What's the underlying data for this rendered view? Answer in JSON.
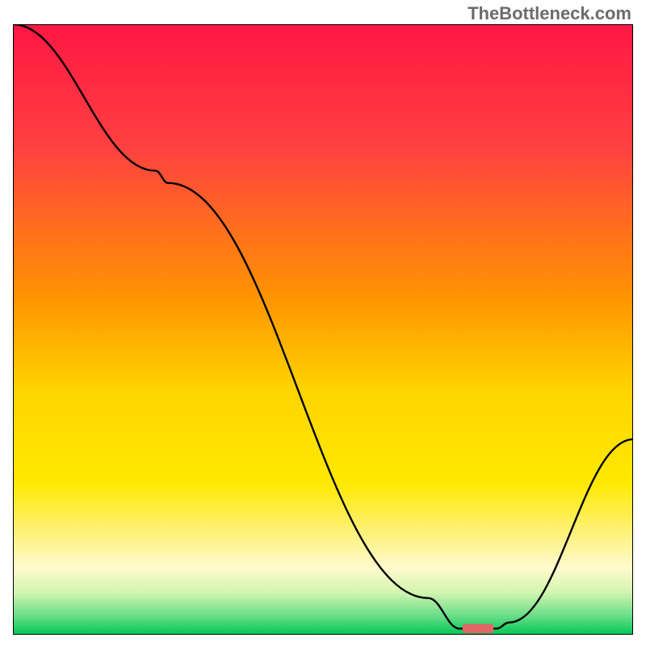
{
  "watermark": "TheBottleneck.com",
  "chart_data": {
    "type": "line",
    "title": "",
    "xlabel": "",
    "ylabel": "",
    "xlim": [
      0,
      100
    ],
    "ylim": [
      0,
      100
    ],
    "series": [
      {
        "name": "curve",
        "x": [
          0,
          23,
          25,
          67,
          72,
          78,
          80,
          100
        ],
        "values": [
          100,
          76,
          74,
          6,
          1,
          1,
          2,
          32
        ]
      }
    ],
    "marker": {
      "x": 75,
      "y": 1,
      "color": "#e06666",
      "width": 5,
      "height": 1.5
    },
    "gradient_stops": [
      {
        "offset": 0,
        "color": "#ff1744"
      },
      {
        "offset": 20,
        "color": "#ff4040"
      },
      {
        "offset": 45,
        "color": "#ff9500"
      },
      {
        "offset": 60,
        "color": "#ffd400"
      },
      {
        "offset": 75,
        "color": "#ffe900"
      },
      {
        "offset": 83,
        "color": "#fff176"
      },
      {
        "offset": 89,
        "color": "#fffacd"
      },
      {
        "offset": 93,
        "color": "#d4f5b0"
      },
      {
        "offset": 97,
        "color": "#66dd88"
      },
      {
        "offset": 100,
        "color": "#00c853"
      }
    ],
    "frame_color": "#000000",
    "frame_width": 2
  }
}
